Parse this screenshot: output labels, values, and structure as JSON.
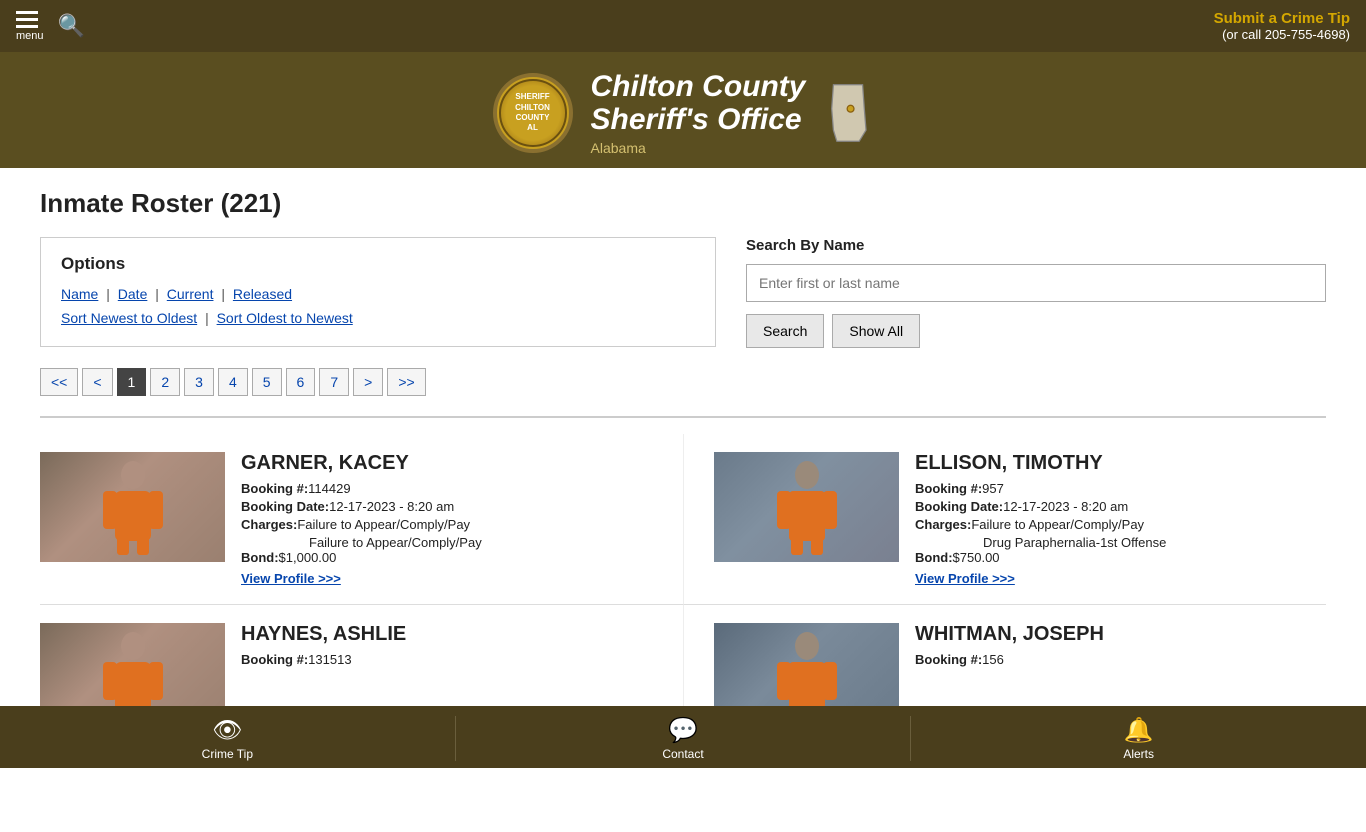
{
  "topNav": {
    "menuLabel": "menu",
    "crimeTipText": "Submit a Crime Tip",
    "callText": "(or call 205-755-4698)"
  },
  "header": {
    "badgeText": "SHERIFF\nCHILTON\nCOUNTY\nAL",
    "titleLine1": "Chilton County",
    "titleLine2": "Sheriff's Office",
    "subtitle": "Alabama"
  },
  "pageTitle": "Inmate Roster (221)",
  "options": {
    "title": "Options",
    "links": {
      "name": "Name",
      "date": "Date",
      "current": "Current",
      "released": "Released"
    },
    "sortNewest": "Sort Newest to Oldest",
    "sortOldest": "Sort Oldest to Newest"
  },
  "searchByName": {
    "label": "Search By Name",
    "placeholder": "Enter first or last name",
    "searchButton": "Search",
    "showAllButton": "Show All"
  },
  "pagination": {
    "first": "<<",
    "prev": "<",
    "pages": [
      "1",
      "2",
      "3",
      "4",
      "5",
      "6",
      "7"
    ],
    "next": ">",
    "last": ">>",
    "activePage": "1"
  },
  "inmates": [
    {
      "name": "GARNER, KACEY",
      "bookingNum": "114429",
      "bookingDate": "12-17-2023 - 8:20 am",
      "charges": [
        "Failure to Appear/Comply/Pay",
        "Failure to Appear/Comply/Pay"
      ],
      "bond": "$1,000.00",
      "viewProfile": "View Profile >>>",
      "photoType": "female"
    },
    {
      "name": "ELLISON, TIMOTHY",
      "bookingNum": "957",
      "bookingDate": "12-17-2023 - 8:20 am",
      "charges": [
        "Failure to Appear/Comply/Pay",
        "Drug Paraphernalia-1st Offense"
      ],
      "bond": "$750.00",
      "viewProfile": "View Profile >>>",
      "photoType": "male1"
    },
    {
      "name": "HAYNES, ASHLIE",
      "bookingNum": "131513",
      "bookingDate": "",
      "charges": [],
      "bond": "",
      "viewProfile": "",
      "photoType": "female"
    },
    {
      "name": "WHITMAN, JOSEPH",
      "bookingNum": "156",
      "bookingDate": "",
      "charges": [],
      "bond": "",
      "viewProfile": "",
      "photoType": "male2"
    }
  ],
  "bottomNav": {
    "items": [
      {
        "label": "Crime Tip",
        "icon": "👁"
      },
      {
        "label": "Contact",
        "icon": "💬"
      },
      {
        "label": "Alerts",
        "icon": "🔔"
      }
    ]
  }
}
